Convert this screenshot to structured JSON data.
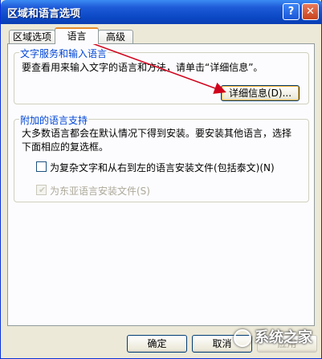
{
  "window": {
    "title": "区域和语言选项",
    "help_glyph": "?",
    "close_glyph": "✕"
  },
  "tabs": [
    {
      "label": "区域选项"
    },
    {
      "label": "语言",
      "selected": true
    },
    {
      "label": "高级"
    }
  ],
  "text_services": {
    "legend": "文字服务和输入语言",
    "description": "要查看用来输入文字的语言和方法，请单击“详细信息”。",
    "details_button": "详细信息(D)..."
  },
  "supplemental": {
    "legend": "附加的语言支持",
    "description_line1": "大多数语言都会在默认情况下得到安装。要安装其他语言，选择",
    "description_line2": "下面相应的复选框。",
    "checkbox_complex": {
      "label": "为复杂文字和从右到左的语言安装文件(包括泰文)(N)",
      "checked": false,
      "enabled": true
    },
    "checkbox_east_asian": {
      "label": "为东亚语言安装文件(S)",
      "checked": true,
      "enabled": false
    }
  },
  "footer": {
    "ok": "确定",
    "cancel": "取消",
    "apply": "应用"
  },
  "watermark": {
    "text": "系统之家"
  },
  "colors": {
    "titlebar": "#0b49c6",
    "legend_text": "#0046d5",
    "annotation_arrow": "#d0021b",
    "selected_tab_accent": "#e68b2c"
  },
  "icons": {
    "check": "✔"
  }
}
